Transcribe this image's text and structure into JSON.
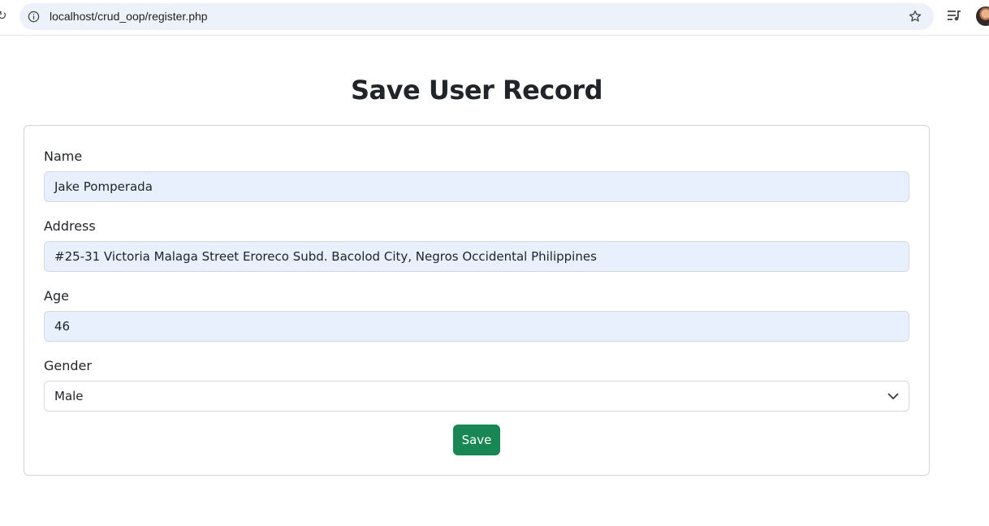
{
  "browser": {
    "url": "localhost/crud_oop/register.php"
  },
  "page": {
    "title": "Save User Record"
  },
  "form": {
    "name": {
      "label": "Name",
      "value": "Jake Pomperada"
    },
    "address": {
      "label": "Address",
      "value": "#25-31 Victoria Malaga Street Eroreco Subd. Bacolod City, Negros Occidental Philippines"
    },
    "age": {
      "label": "Age",
      "value": "46"
    },
    "gender": {
      "label": "Gender",
      "value": "Male"
    },
    "save_label": "Save"
  },
  "colors": {
    "save_button": "#198754",
    "autofill_input": "#e8f0fe"
  }
}
